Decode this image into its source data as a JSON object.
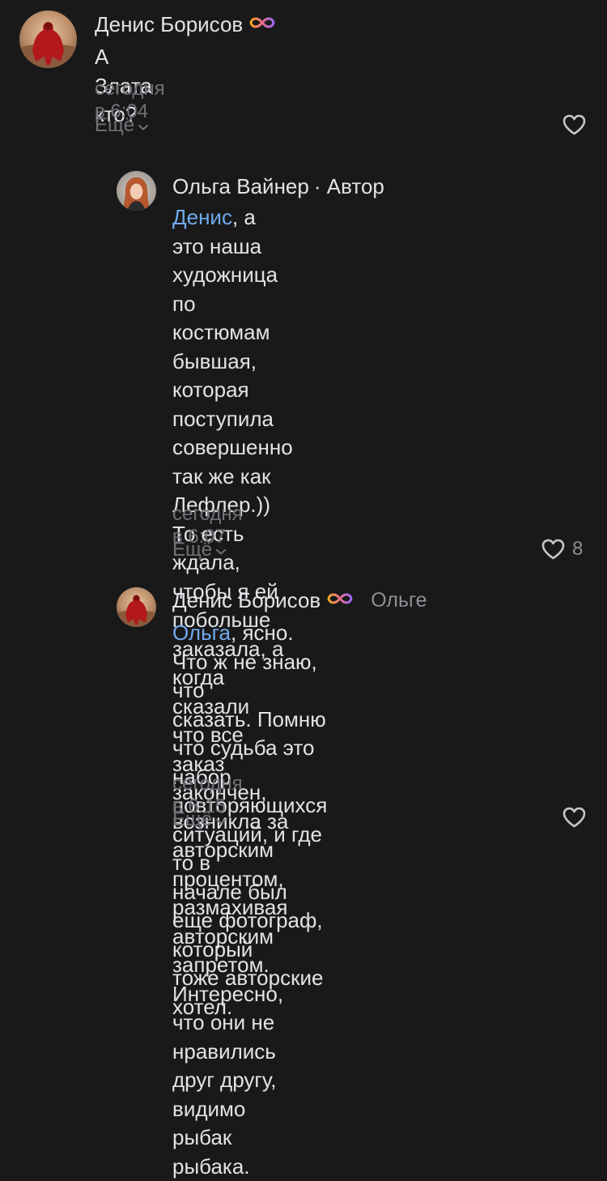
{
  "comments": [
    {
      "author": "Денис Борисов",
      "text": "А Злата кто?",
      "time": "сегодня в 6:04",
      "more_label": "Ещё"
    },
    {
      "author": "Ольга Вайнер",
      "author_badge": "· Автор",
      "mention": "Денис",
      "text_after_mention": ", а это наша художница по\nкостюмам бывшая, которая\nпоступила совершенно так же как\nЛефлер.)) То есть ждала, чтобы я ей\nпобольше заказала, а когда сказали\nчто все заказ закончен, возникла за\nавторским процентом, размахивая\nавторским запретом.\nИнтересно, что они не нравились\nдруг другу, видимо рыбак рыбака.",
      "time": "сегодня в 6:07",
      "more_label": "Ещё",
      "likes": "8"
    },
    {
      "author": "Денис Борисов",
      "reply_to": "Ольге",
      "mention": "Ольга",
      "text_after_mention": ", ясно. Что ж не знаю, что\nсказать. Помню что судьба это набор\nповторяющихся ситуаций, и где то в\nначале был еще фотограф, который\nтоже авторские хотел.",
      "time": "сегодня в 6:15",
      "more_label": "Ещё"
    }
  ],
  "colors": {
    "background": "#19191a",
    "text": "#e1e3e6",
    "secondary": "#6f7276",
    "mention": "#71aaeb",
    "infinity_gradient": [
      "#f5a623",
      "#b86bff"
    ]
  }
}
